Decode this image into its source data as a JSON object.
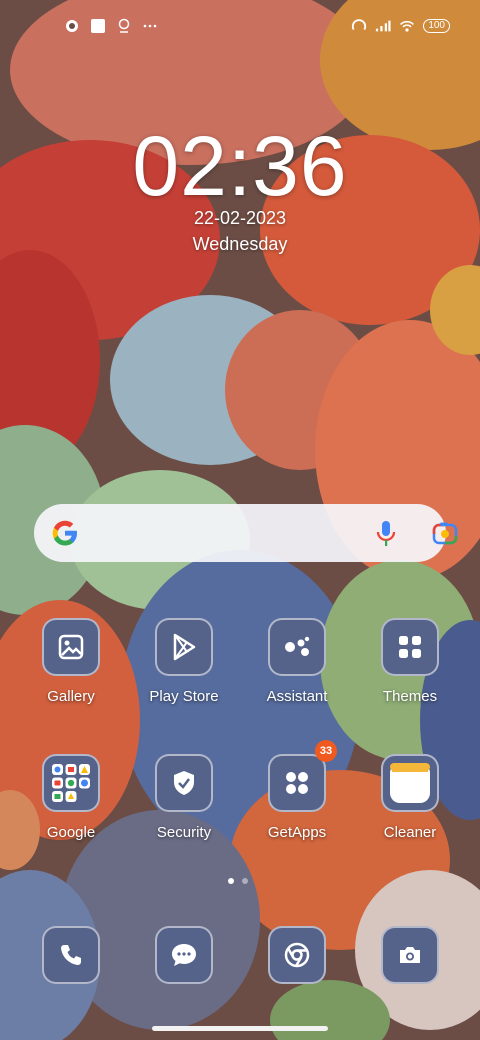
{
  "status_bar": {
    "left_icons": [
      "cast-icon",
      "square-notification-icon",
      "location-pin-icon",
      "more-dots-icon"
    ],
    "right_icons": [
      "hotspot-icon",
      "signal-icon",
      "wifi-icon"
    ],
    "battery": "100"
  },
  "clock": {
    "time": "02:36",
    "date": "22-02-2023",
    "day": "Wednesday"
  },
  "search": {
    "icons": [
      "google-g-icon",
      "mic-icon",
      "lens-icon"
    ]
  },
  "apps_row1": [
    {
      "label": "Gallery",
      "icon": "gallery-icon"
    },
    {
      "label": "Play Store",
      "icon": "play-store-icon"
    },
    {
      "label": "Assistant",
      "icon": "assistant-icon"
    },
    {
      "label": "Themes",
      "icon": "themes-icon"
    }
  ],
  "apps_row2": [
    {
      "label": "Google",
      "icon": "google-folder-icon"
    },
    {
      "label": "Security",
      "icon": "security-shield-icon"
    },
    {
      "label": "GetApps",
      "icon": "getapps-icon",
      "badge": "33"
    },
    {
      "label": "Cleaner",
      "icon": "cleaner-icon"
    }
  ],
  "page_indicator": {
    "pages": 2,
    "active": 1
  },
  "dock": [
    {
      "icon": "phone-icon"
    },
    {
      "icon": "messages-icon"
    },
    {
      "icon": "chrome-icon"
    },
    {
      "icon": "camera-icon"
    }
  ],
  "colors": {
    "tile": "#55628a",
    "badge": "#f05a1e",
    "search_bg": "#f5f5fa"
  }
}
